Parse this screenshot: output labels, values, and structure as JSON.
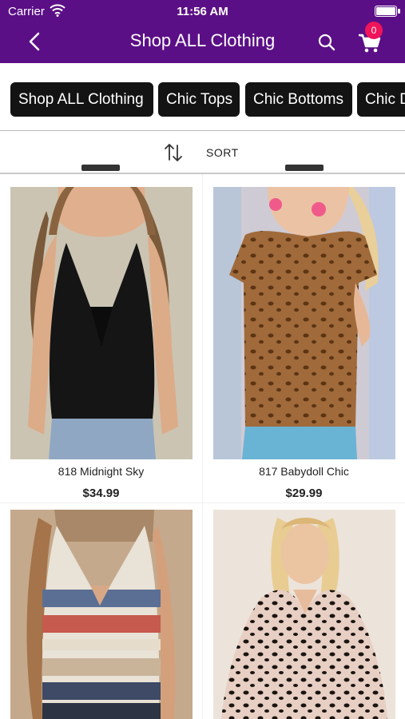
{
  "status_bar": {
    "carrier": "Carrier",
    "time": "11:56 AM"
  },
  "header": {
    "title": "Shop ALL Clothing",
    "cart_count": "0",
    "bg_color": "#5b0f86"
  },
  "categories": [
    "Shop ALL Clothing",
    "Chic Tops",
    "Chic Bottoms",
    "Chic D"
  ],
  "sort": {
    "label": "SORT"
  },
  "products": [
    {
      "name": "818 Midnight Sky",
      "price": "$34.99"
    },
    {
      "name": "817 Babydoll Chic",
      "price": "$29.99"
    }
  ],
  "icons": [
    "back-chevron-icon",
    "search-icon",
    "cart-icon",
    "sort-arrows-icon",
    "wifi-icon",
    "battery-icon"
  ]
}
